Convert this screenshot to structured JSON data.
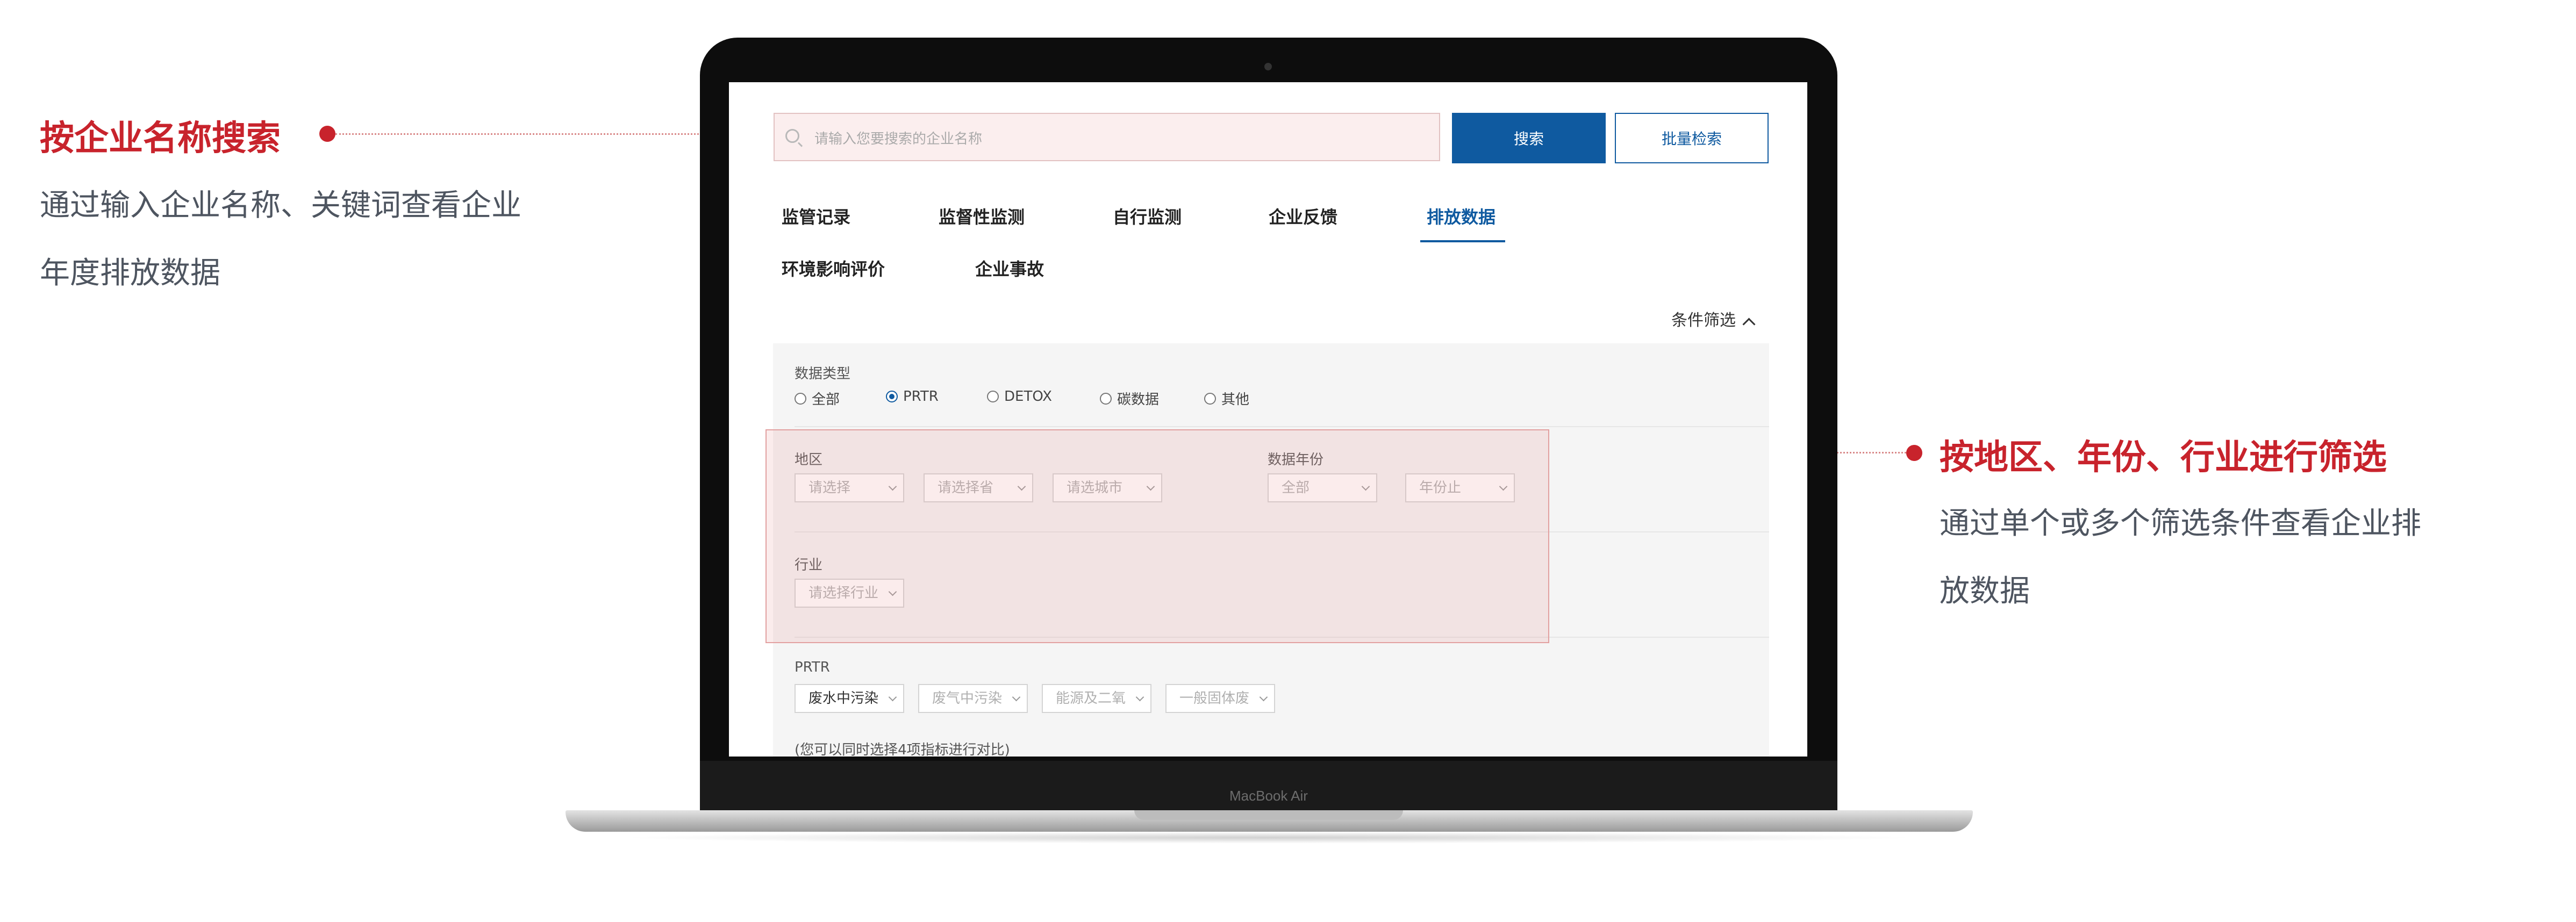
{
  "annotations": {
    "left": {
      "title": "按企业名称搜索",
      "desc_line1": "通过输入企业名称、关键词查看企业",
      "desc_line2": "年度排放数据"
    },
    "right": {
      "title": "按地区、年份、行业进行筛选",
      "desc_line1": "通过单个或多个筛选条件查看企业排",
      "desc_line2": "放数据"
    },
    "accent_color": "#c8232c"
  },
  "device": {
    "model_label": "MacBook Air"
  },
  "search": {
    "placeholder": "请输入您要搜索的企业名称",
    "search_button": "搜索",
    "batch_button": "批量检索"
  },
  "tabs": [
    {
      "label": "监管记录"
    },
    {
      "label": "监督性监测"
    },
    {
      "label": "自行监测"
    },
    {
      "label": "企业反馈"
    },
    {
      "label": "排放数据",
      "active": true
    },
    {
      "label": "环境影响评价"
    },
    {
      "label": "企业事故"
    }
  ],
  "filter": {
    "toggle_label": "条件筛选",
    "data_type": {
      "label": "数据类型",
      "options": [
        "全部",
        "PRTR",
        "DETOX",
        "碳数据",
        "其他"
      ],
      "selected": "PRTR"
    },
    "region": {
      "label": "地区",
      "select1": "请选择",
      "select2": "请选择省",
      "select3": "请选城市"
    },
    "year": {
      "label": "数据年份",
      "from": "全部",
      "separator": "–",
      "to": "年份止"
    },
    "industry": {
      "label": "行业",
      "select": "请选择行业"
    },
    "prtr": {
      "label": "PRTR",
      "select1": "废水中污染",
      "select2": "废气中污染",
      "select3": "能源及二氧",
      "select4": "一般固体废"
    },
    "note": "(您可以同时选择4项指标进行对比)"
  },
  "colors": {
    "primary": "#0f5aa0",
    "highlight": "#e2a0a0"
  }
}
